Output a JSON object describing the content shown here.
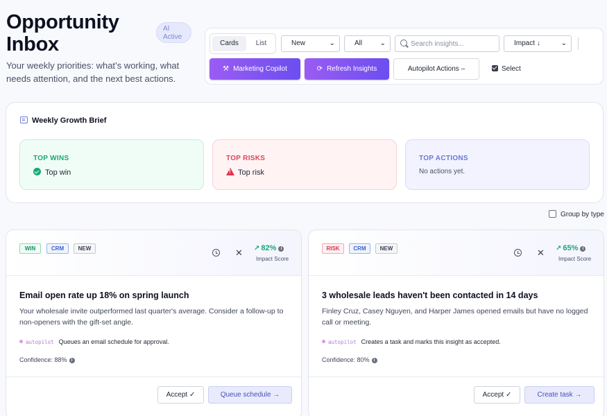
{
  "header": {
    "title_line1": "Opportunity",
    "title_line2": "Inbox",
    "ai_badge_line1": "AI",
    "ai_badge_line2": "Active",
    "subtitle": "Your weekly priorities: what’s working, what needs attention, and the next best actions."
  },
  "toolbar": {
    "view_cards": "Cards",
    "view_list": "List",
    "status_filter": "New",
    "type_filter": "All",
    "search_placeholder": "Search insights...",
    "sort": "Impact ↓",
    "copilot_label": "Marketing Copilot",
    "refresh_label": "Refresh Insights",
    "autopilot_label": "Autopilot Actions –",
    "select_label": "Select"
  },
  "brief": {
    "title": "Weekly Growth Brief",
    "wins_heading": "TOP WINS",
    "wins_value": "Top win",
    "risks_heading": "TOP RISKS",
    "risks_value": "Top risk",
    "actions_heading": "TOP ACTIONS",
    "actions_value": "No actions yet."
  },
  "group_by_type_label": "Group by type",
  "cards": [
    {
      "tags": [
        "WIN",
        "CRM",
        "NEW"
      ],
      "score": "82%",
      "score_label": "Impact Score",
      "title": "Email open rate up 18% on spring launch",
      "description": "Your wholesale invite outperformed last quarter's average. Consider a follow-up to non-openers with the gift-set angle.",
      "autopilot_tag": "autopilot",
      "autopilot_text": "Queues an email schedule for approval.",
      "confidence": "Confidence: 88%",
      "accept_label": "Accept ✓",
      "primary_label": "Queue schedule →"
    },
    {
      "tags": [
        "RISK",
        "CRM",
        "NEW"
      ],
      "score": "65%",
      "score_label": "Impact Score",
      "title": "3 wholesale leads haven't been contacted in 14 days",
      "description": "Finley Cruz, Casey Nguyen, and Harper James opened emails but have no logged call or meeting.",
      "autopilot_tag": "autopilot",
      "autopilot_text": "Creates a task and marks this insight as accepted.",
      "confidence": "Confidence: 80%",
      "accept_label": "Accept ✓",
      "primary_label": "Create task →"
    }
  ]
}
